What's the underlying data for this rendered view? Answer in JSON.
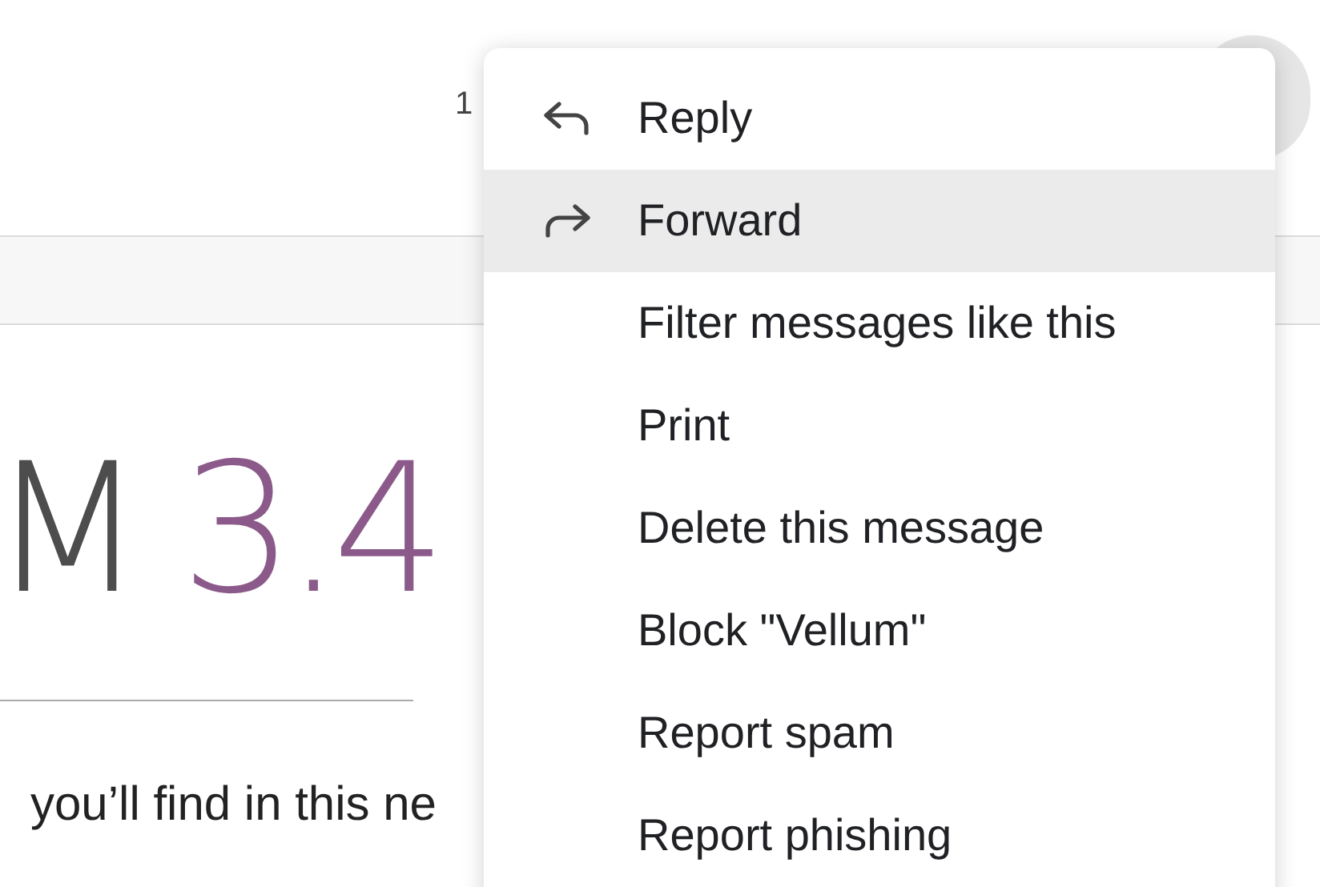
{
  "email": {
    "time": "1",
    "headline": {
      "prefix": "M",
      "version": "3.4"
    },
    "body": "you’ll find in this ne"
  },
  "menu": {
    "items": [
      {
        "label": "Reply",
        "kind": "reply",
        "selected": false
      },
      {
        "label": "Forward",
        "kind": "forward",
        "selected": true
      },
      {
        "label": "Filter messages like this",
        "selected": false
      },
      {
        "label": "Print",
        "selected": false
      },
      {
        "label": "Delete this message",
        "selected": false
      },
      {
        "label": "Block \"Vellum\"",
        "selected": false
      },
      {
        "label": "Report spam",
        "selected": false
      },
      {
        "label": "Report phishing",
        "selected": false
      }
    ]
  }
}
